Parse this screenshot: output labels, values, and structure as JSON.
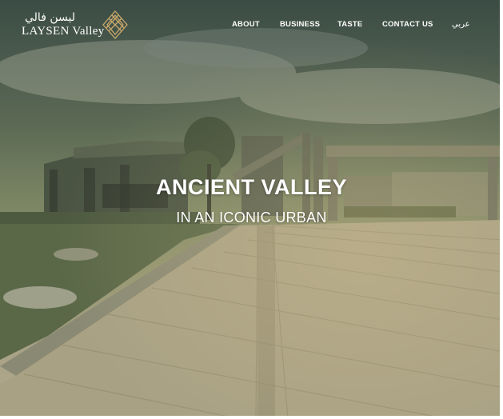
{
  "brand": {
    "name_en": "LAYSEN Valley",
    "name_ar": "ليسن فالي",
    "emblem_icon": "diamond-lattice-icon",
    "accent_color": "#c9a86a"
  },
  "nav": {
    "items": [
      {
        "label": "ABOUT"
      },
      {
        "label": "BUSINESS"
      },
      {
        "label": "TASTE"
      },
      {
        "label": "CONTACT US"
      }
    ],
    "language_toggle": "عربي"
  },
  "hero": {
    "title": "ANCIENT VALLEY",
    "subtitle": "IN AN ICONIC URBAN",
    "background_icon": "hero-photo-paved-plaza-with-buildings"
  }
}
